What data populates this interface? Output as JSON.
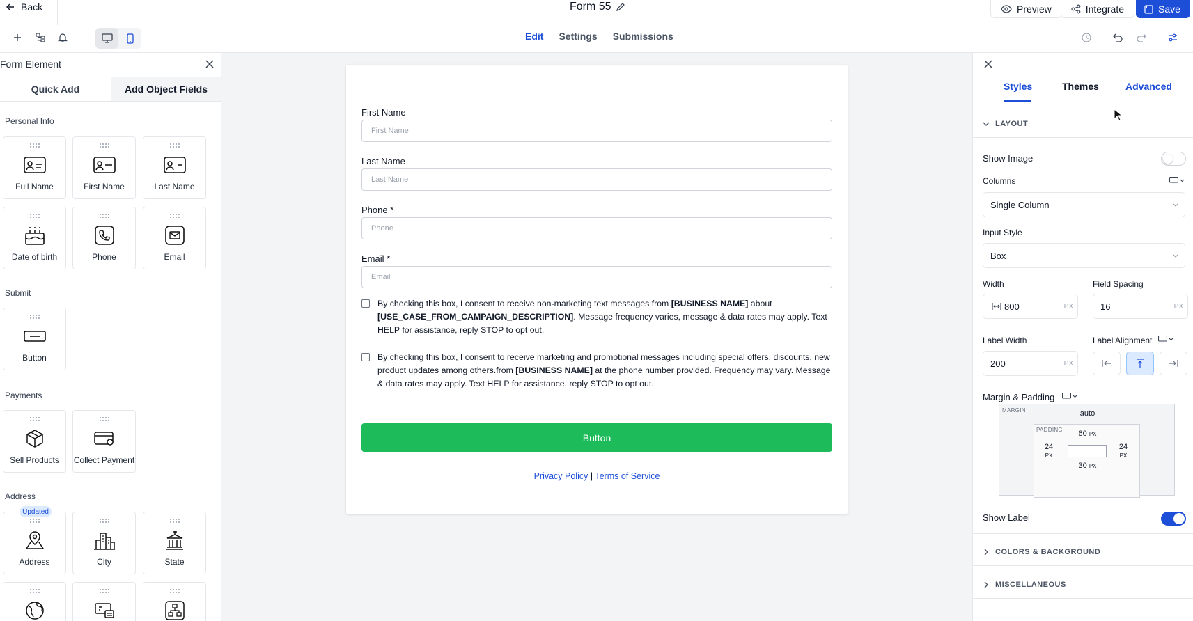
{
  "topbar": {
    "back_label": "Back",
    "form_title": "Form 55",
    "preview_label": "Preview",
    "integrate_label": "Integrate",
    "save_label": "Save",
    "tabs": [
      "Edit",
      "Settings",
      "Submissions"
    ],
    "active_tab": "Edit"
  },
  "left_panel": {
    "title": "Form Element",
    "tabs": [
      "Quick Add",
      "Add Object Fields"
    ],
    "sections": {
      "personal_info": "Personal Info",
      "submit": "Submit",
      "payments": "Payments",
      "address": "Address"
    },
    "items": {
      "full_name": "Full Name",
      "first_name": "First Name",
      "last_name": "Last Name",
      "date_of_birth": "Date of birth",
      "phone": "Phone",
      "email": "Email",
      "button": "Button",
      "sell_products": "Sell Products",
      "collect_payment": "Collect Payment",
      "address": "Address",
      "city": "City",
      "state": "State"
    },
    "updated_badge": "Updated"
  },
  "form": {
    "fields": [
      {
        "label": "First Name",
        "placeholder": "First Name"
      },
      {
        "label": "Last Name",
        "placeholder": "Last Name"
      },
      {
        "label": "Phone *",
        "placeholder": "Phone"
      },
      {
        "label": "Email *",
        "placeholder": "Email"
      }
    ],
    "consent1": {
      "prefix": "By checking this box, I consent to receive non-marketing text messages from ",
      "business": "[BUSINESS NAME]",
      "middle": " about ",
      "use_case": "[USE_CASE_FROM_CAMPAIGN_DESCRIPTION]",
      "suffix": ". Message frequency varies, message & data rates may apply. Text HELP for assistance, reply STOP to opt out."
    },
    "consent2": {
      "prefix": "By checking this box, I consent to receive marketing and promotional messages including special offers, discounts, new product updates among others.from ",
      "business": "[BUSINESS NAME]",
      "suffix": " at the phone number provided. Frequency may vary. Message & data rates may apply. Text HELP for assistance, reply STOP to opt out."
    },
    "button_label": "Button",
    "privacy_label": "Privacy Policy",
    "separator": "|",
    "terms_label": "Terms of Service"
  },
  "right_panel": {
    "tabs": [
      "Styles",
      "Themes",
      "Advanced"
    ],
    "active_tab": "Styles",
    "layout_heading": "LAYOUT",
    "show_image_label": "Show Image",
    "show_image_on": false,
    "columns_label": "Columns",
    "columns_value": "Single Column",
    "input_style_label": "Input Style",
    "input_style_value": "Box",
    "width_label": "Width",
    "width_value": "800",
    "width_unit": "PX",
    "field_spacing_label": "Field Spacing",
    "field_spacing_value": "16",
    "field_spacing_unit": "PX",
    "label_width_label": "Label Width",
    "label_width_value": "200",
    "label_width_unit": "PX",
    "label_alignment_label": "Label Alignment",
    "margin_padding_label": "Margin & Padding",
    "margin_title": "MARGIN",
    "margin_value": "auto",
    "padding_title": "PADDING",
    "padding_top": "60",
    "padding_left": "24",
    "padding_right": "24",
    "padding_bottom": "30",
    "px_unit": "PX",
    "show_label_label": "Show Label",
    "show_label_on": true,
    "colors_heading": "COLORS & BACKGROUND",
    "misc_heading": "MISCELLANEOUS"
  },
  "colors": {
    "accent": "#1d4ed8",
    "submit_button": "#1dbb5a"
  }
}
